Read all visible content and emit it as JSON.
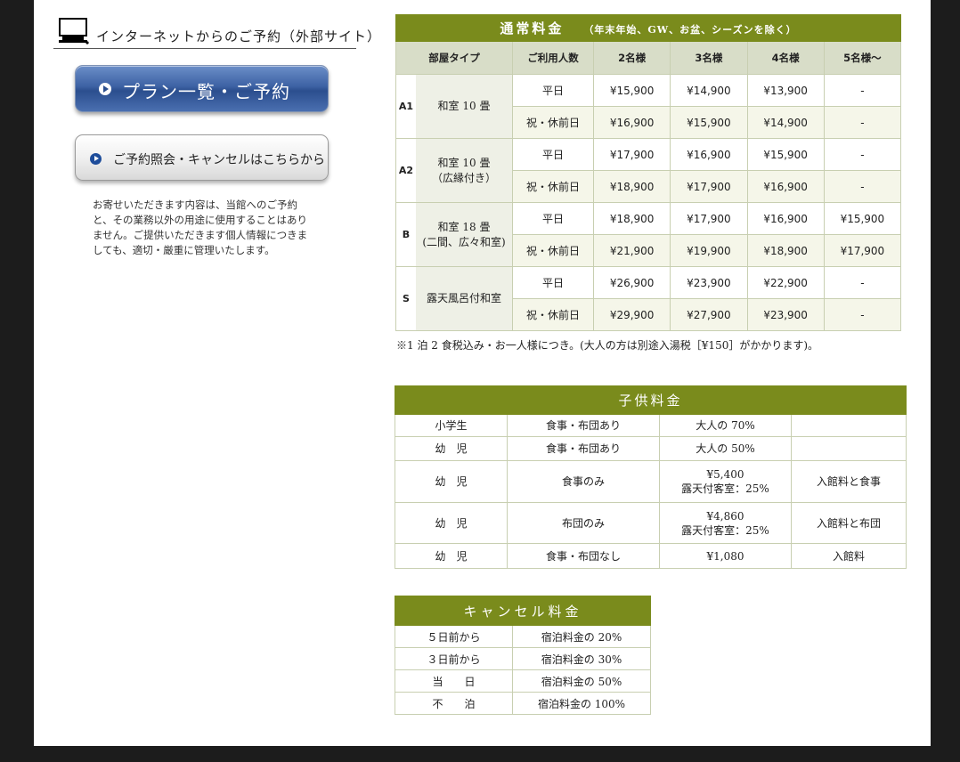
{
  "left": {
    "net_heading": "インターネットからのご予約（外部サイト）",
    "plan_button": "プラン一覧・ご予約",
    "inquiry_button": "ご予約照会・キャンセルはこちらから",
    "privacy_note": "お寄せいただきます内容は、当館へのご予約と、その業務以外の用途に使用することはありません。ご提供いただきます個人情報につきましても、適切・厳重に管理いたします。"
  },
  "regular": {
    "title": "通常料金",
    "title_note": "（年末年始、GW、お盆、シーズンを除く）",
    "headers": [
      "部屋タイプ",
      "ご利用人数",
      "2名様",
      "3名様",
      "4名様",
      "5名様〜"
    ],
    "rooms": [
      {
        "code": "A1",
        "name": "和室 10 畳",
        "sub": "",
        "rows": [
          {
            "day": "平日",
            "p2": "¥15,900",
            "p3": "¥14,900",
            "p4": "¥13,900",
            "p5": "-"
          },
          {
            "day": "祝・休前日",
            "p2": "¥16,900",
            "p3": "¥15,900",
            "p4": "¥14,900",
            "p5": "-"
          }
        ]
      },
      {
        "code": "A2",
        "name": "和室 10 畳",
        "sub": "（広縁付き）",
        "rows": [
          {
            "day": "平日",
            "p2": "¥17,900",
            "p3": "¥16,900",
            "p4": "¥15,900",
            "p5": "-"
          },
          {
            "day": "祝・休前日",
            "p2": "¥18,900",
            "p3": "¥17,900",
            "p4": "¥16,900",
            "p5": "-"
          }
        ]
      },
      {
        "code": "B",
        "name": "和室 18 畳",
        "sub": "(二間、広々和室)",
        "rows": [
          {
            "day": "平日",
            "p2": "¥18,900",
            "p3": "¥17,900",
            "p4": "¥16,900",
            "p5": "¥15,900"
          },
          {
            "day": "祝・休前日",
            "p2": "¥21,900",
            "p3": "¥19,900",
            "p4": "¥18,900",
            "p5": "¥17,900"
          }
        ]
      },
      {
        "code": "S",
        "name": "露天風呂付和室",
        "sub": "",
        "rows": [
          {
            "day": "平日",
            "p2": "¥26,900",
            "p3": "¥23,900",
            "p4": "¥22,900",
            "p5": "-"
          },
          {
            "day": "祝・休前日",
            "p2": "¥29,900",
            "p3": "¥27,900",
            "p4": "¥23,900",
            "p5": "-"
          }
        ]
      }
    ],
    "note": "※1 泊 2 食税込み・お一人様につき。(大人の方は別途入湯税［¥150］がかかります)。"
  },
  "child": {
    "title": "子供料金",
    "rows": [
      {
        "c1": "小学生",
        "c2": "食事・布団あり",
        "c3a": "大人の 70%",
        "c3b": "",
        "c4": ""
      },
      {
        "c1": "幼　児",
        "c2": "食事・布団あり",
        "c3a": "大人の 50%",
        "c3b": "",
        "c4": ""
      },
      {
        "c1": "幼　児",
        "c2": "食事のみ",
        "c3a": "¥5,400",
        "c3b": "露天付客室：25%",
        "c4": "入館料と食事"
      },
      {
        "c1": "幼　児",
        "c2": "布団のみ",
        "c3a": "¥4,860",
        "c3b": "露天付客室：25%",
        "c4": "入館料と布団"
      },
      {
        "c1": "幼　児",
        "c2": "食事・布団なし",
        "c3a": "¥1,080",
        "c3b": "",
        "c4": "入館料"
      }
    ]
  },
  "cancel": {
    "title": "キャンセル料金",
    "rows": [
      {
        "when": "５日前から",
        "fee": "宿泊料金の 20%"
      },
      {
        "when": "３日前から",
        "fee": "宿泊料金の 30%"
      },
      {
        "when": "当　　日",
        "fee": "宿泊料金の 50%"
      },
      {
        "when": "不　　泊",
        "fee": "宿泊料金の 100%"
      }
    ]
  }
}
